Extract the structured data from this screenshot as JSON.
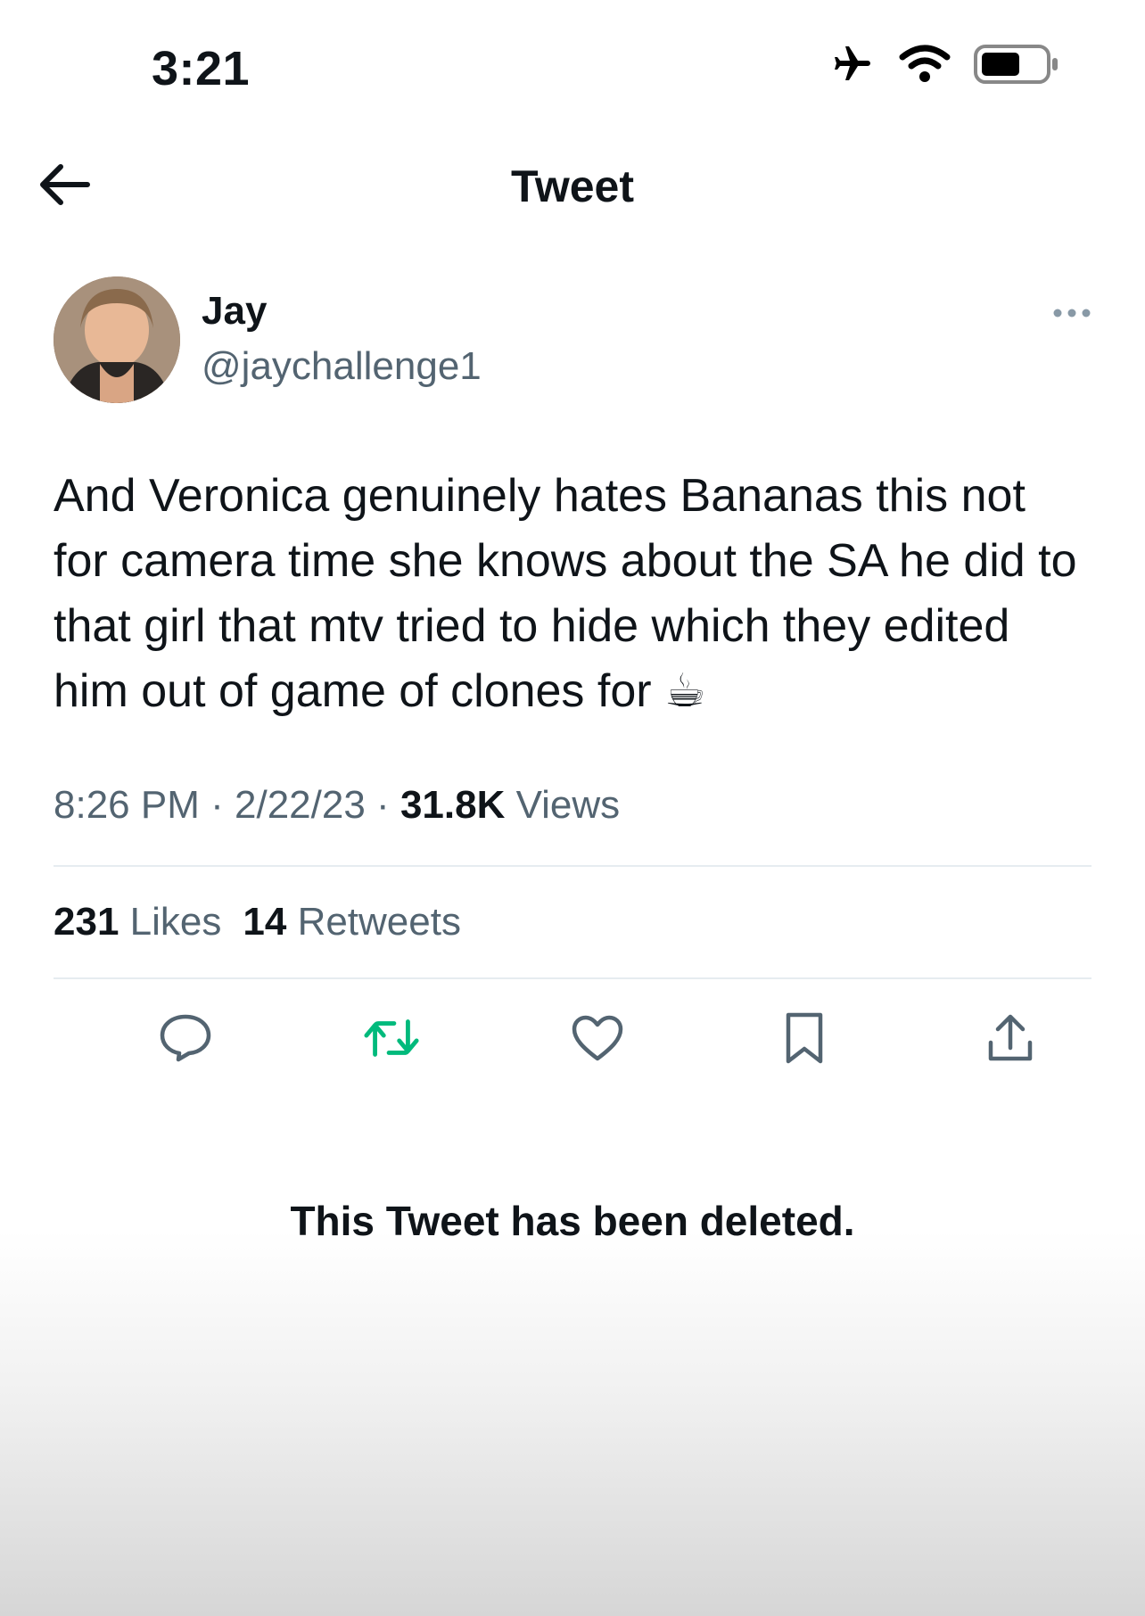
{
  "status_bar": {
    "time": "3:21",
    "icons": [
      "airplane-icon",
      "wifi-icon",
      "battery-icon"
    ]
  },
  "nav": {
    "back_icon": "arrow-left-icon",
    "title": "Tweet"
  },
  "tweet": {
    "author_name": "Jay",
    "author_handle": "@jaychallenge1",
    "more_icon": "more-icon",
    "text": "And Veronica genuinely hates Bananas this not for camera time she knows about the SA he did to that girl that mtv tried to hide  which they edited him out of game of clones for ☕",
    "time": "8:26 PM",
    "separator": "·",
    "date": "2/22/23",
    "views_count": "31.8K",
    "views_label": "Views",
    "likes_count": "231",
    "likes_label": "Likes",
    "retweets_count": "14",
    "retweets_label": "Retweets",
    "actions": [
      "reply-icon",
      "retweet-icon",
      "like-icon",
      "bookmark-icon",
      "share-icon"
    ],
    "retweet_color": "#00ba7c"
  },
  "quoted": {
    "deleted_message": "This Tweet has been deleted."
  }
}
